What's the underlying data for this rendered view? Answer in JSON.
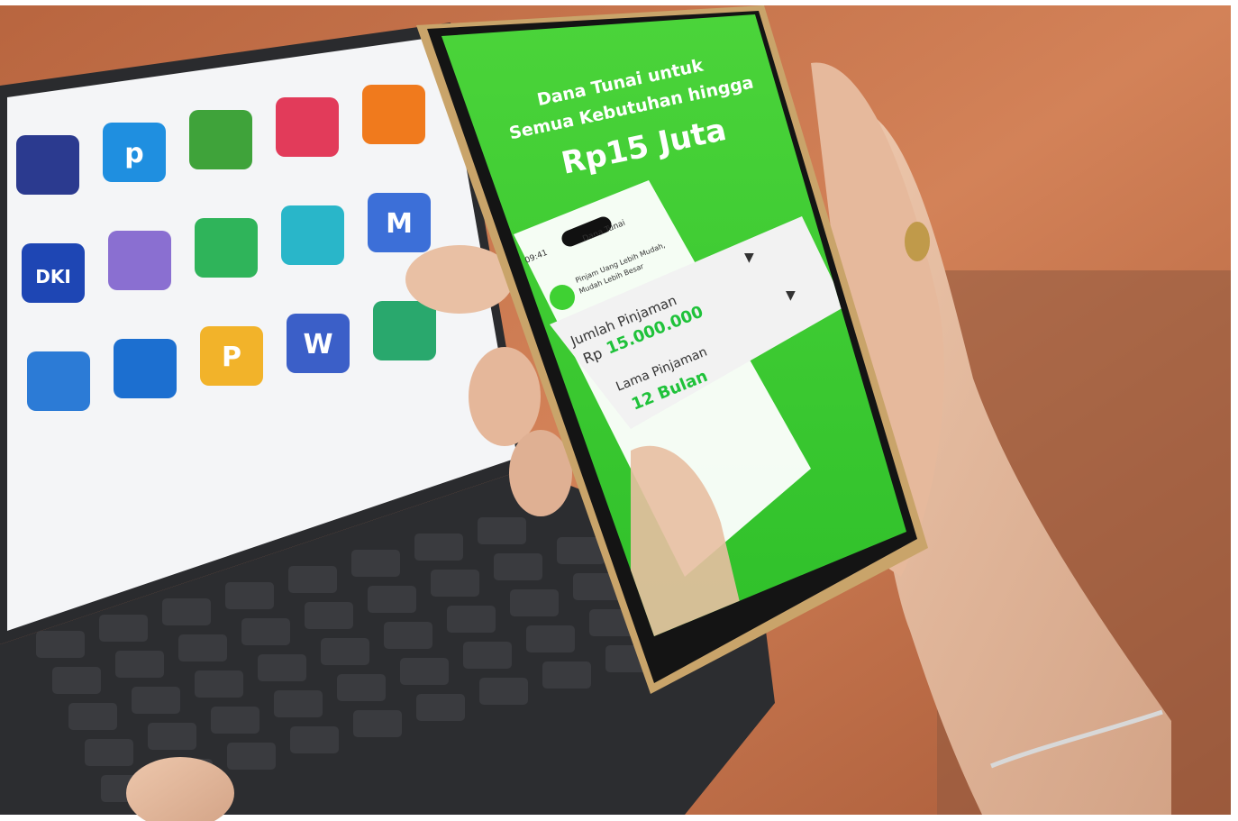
{
  "photo": {
    "tablet_tiles": [
      {
        "label": "",
        "color": "#2b3a8f"
      },
      {
        "label": "p",
        "color": "#1f8fe0"
      },
      {
        "label": "",
        "color": "#3fa33a"
      },
      {
        "label": "",
        "color": "#e23b5a"
      },
      {
        "label": "",
        "color": "#f07a1d"
      },
      {
        "label": "DKI",
        "color": "#1e46b4"
      },
      {
        "label": "",
        "color": "#8a6fd1"
      },
      {
        "label": "",
        "color": "#2fb45a"
      },
      {
        "label": "",
        "color": "#29b6c9"
      },
      {
        "label": "M",
        "color": "#3c6fd8"
      },
      {
        "label": "",
        "color": "#2c7bd6"
      },
      {
        "label": "",
        "color": "#1c6fd0"
      },
      {
        "label": "P",
        "color": "#f2b32a"
      },
      {
        "label": "W",
        "color": "#3b5fc8"
      },
      {
        "label": "",
        "color": "#29a86d"
      }
    ],
    "phone_screen": {
      "headline_line1": "Dana Tunai untuk",
      "headline_line2": "Semua Kebutuhan hingga",
      "headline_amount": "Rp15 Juta",
      "mock_time": "09:41",
      "mock_title": "Dana Tunai",
      "tagline_line1": "Pinjam Uang Lebih Mudah,",
      "tagline_line2": "Mudah Lebih Besar",
      "loan_amount_label": "Jumlah Pinjaman",
      "loan_currency": "Rp",
      "loan_amount_value": "15.000.000",
      "loan_term_label": "Lama Pinjaman",
      "loan_term_value": "12 Bulan"
    },
    "colors": {
      "screen_green": "#3fd133",
      "table_wood": "#c9734e",
      "tablet_frame": "#2a2b2e",
      "phone_frame": "#c9a46a",
      "skin": "#e2b79c"
    }
  }
}
